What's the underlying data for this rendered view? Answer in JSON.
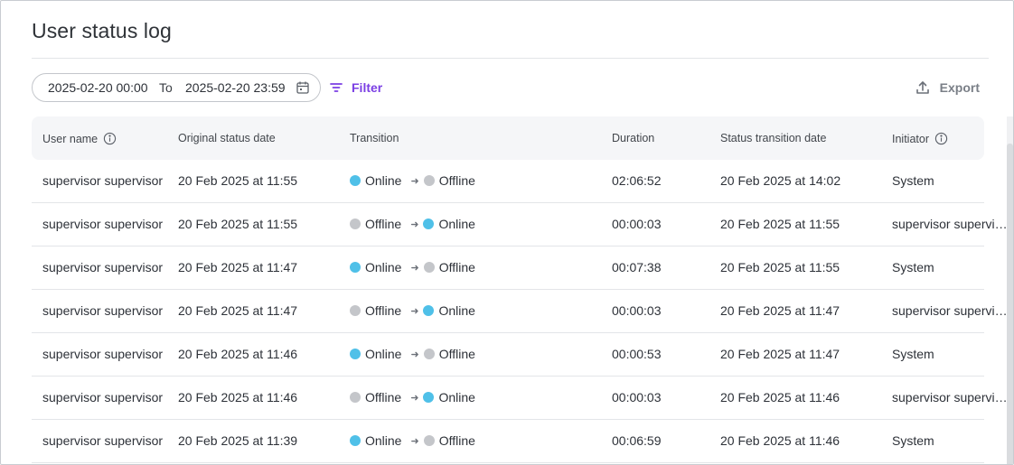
{
  "page": {
    "title": "User status log"
  },
  "toolbar": {
    "date_from": "2025-02-20 00:00",
    "to_label": "To",
    "date_to": "2025-02-20 23:59",
    "filter_label": "Filter",
    "export_label": "Export"
  },
  "colors": {
    "online": "#4fc0e8",
    "offline": "#c4c6ca",
    "accent": "#7b3fe4"
  },
  "table": {
    "headers": {
      "user_name": "User name",
      "original_status_date": "Original status date",
      "transition": "Transition",
      "duration": "Duration",
      "status_transition_date": "Status transition date",
      "initiator": "Initiator"
    },
    "rows": [
      {
        "user": "supervisor supervisor",
        "orig": "20 Feb 2025 at 11:55",
        "from": "Online",
        "to": "Offline",
        "duration": "02:06:52",
        "stat": "20 Feb 2025 at 14:02",
        "initiator": "System"
      },
      {
        "user": "supervisor supervisor",
        "orig": "20 Feb 2025 at 11:55",
        "from": "Offline",
        "to": "Online",
        "duration": "00:00:03",
        "stat": "20 Feb 2025 at 11:55",
        "initiator": "supervisor supervisor"
      },
      {
        "user": "supervisor supervisor",
        "orig": "20 Feb 2025 at 11:47",
        "from": "Online",
        "to": "Offline",
        "duration": "00:07:38",
        "stat": "20 Feb 2025 at 11:55",
        "initiator": "System"
      },
      {
        "user": "supervisor supervisor",
        "orig": "20 Feb 2025 at 11:47",
        "from": "Offline",
        "to": "Online",
        "duration": "00:00:03",
        "stat": "20 Feb 2025 at 11:47",
        "initiator": "supervisor supervisor"
      },
      {
        "user": "supervisor supervisor",
        "orig": "20 Feb 2025 at 11:46",
        "from": "Online",
        "to": "Offline",
        "duration": "00:00:53",
        "stat": "20 Feb 2025 at 11:47",
        "initiator": "System"
      },
      {
        "user": "supervisor supervisor",
        "orig": "20 Feb 2025 at 11:46",
        "from": "Offline",
        "to": "Online",
        "duration": "00:00:03",
        "stat": "20 Feb 2025 at 11:46",
        "initiator": "supervisor supervisor"
      },
      {
        "user": "supervisor supervisor",
        "orig": "20 Feb 2025 at 11:39",
        "from": "Online",
        "to": "Offline",
        "duration": "00:06:59",
        "stat": "20 Feb 2025 at 11:46",
        "initiator": "System"
      }
    ]
  }
}
